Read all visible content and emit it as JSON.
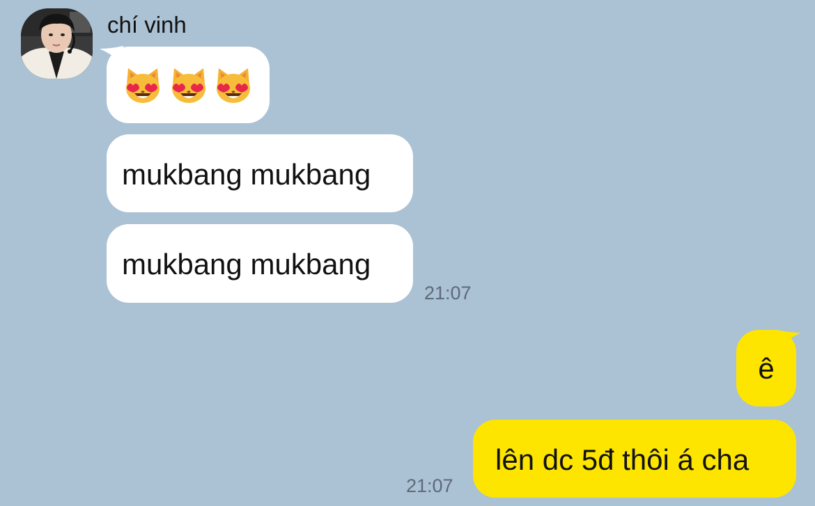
{
  "chat": {
    "sender_name": "chí vinh",
    "incoming": {
      "emoji_message": [
        "cat-heart-eyes-emoji",
        "cat-heart-eyes-emoji",
        "cat-heart-eyes-emoji"
      ],
      "message_2": "mukbang mukbang",
      "message_3": "mukbang mukbang",
      "time": "21:07"
    },
    "outgoing": {
      "message_1": "ê",
      "message_2": "lên dc 5đ thôi á cha",
      "time": "21:07"
    }
  },
  "colors": {
    "background": "#abc1d4",
    "incoming_bubble": "#ffffff",
    "outgoing_bubble": "#fee500",
    "timestamp": "#5d6a78"
  }
}
